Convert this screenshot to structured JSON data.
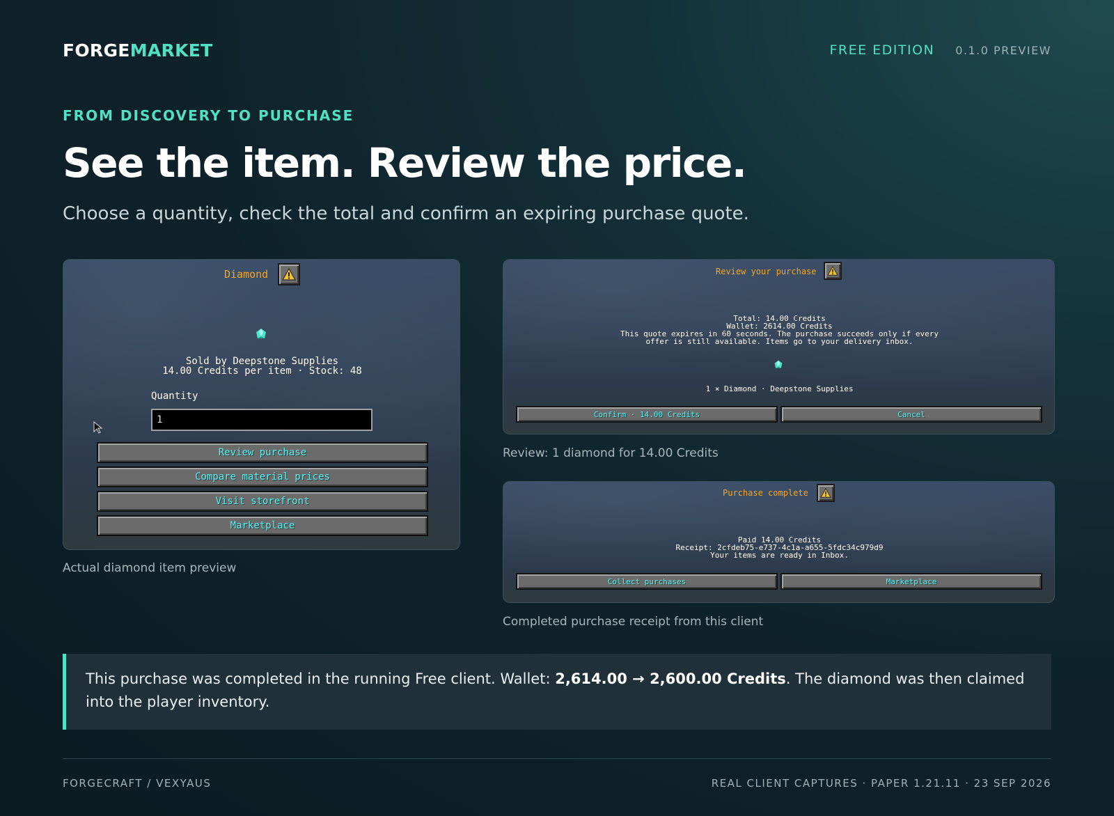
{
  "header": {
    "brand_part1": "FORGE",
    "brand_part2": "MARKET",
    "edition": "FREE EDITION",
    "version": "0.1.0 PREVIEW"
  },
  "hero": {
    "eyebrow": "FROM DISCOVERY TO PURCHASE",
    "headline": "See the item. Review the price.",
    "subhead": "Choose a quantity, check the total and confirm an expiring purchase quote."
  },
  "item_preview": {
    "title": "Diamond",
    "seller_line": "Sold by Deepstone Supplies",
    "price_line": "14.00 Credits per item · Stock: 48",
    "quantity_label": "Quantity",
    "quantity_value": "1",
    "buttons": [
      "Review purchase",
      "Compare material prices",
      "Visit storefront",
      "Marketplace"
    ],
    "caption": "Actual diamond item preview"
  },
  "review": {
    "title": "Review your purchase",
    "total": "Total: 14.00 Credits",
    "wallet": "Wallet: 2614.00 Credits",
    "notice_line1": "This quote expires in 60 seconds. The purchase succeeds only if every",
    "notice_line2": "offer is still available. Items go to your delivery inbox.",
    "summary": "1 × Diamond · Deepstone Supplies",
    "confirm_label": "Confirm · 14.00 Credits",
    "cancel_label": "Cancel",
    "caption": "Review: 1 diamond for 14.00 Credits"
  },
  "receipt": {
    "title": "Purchase complete",
    "paid": "Paid 14.00 Credits",
    "receipt_id": "Receipt: 2cfdeb75-e737-4c1a-a655-5fdc34c979d9",
    "inbox_note": "Your items are ready in Inbox.",
    "collect_label": "Collect purchases",
    "marketplace_label": "Marketplace",
    "caption": "Completed purchase receipt from this client"
  },
  "callout": {
    "text_before": "This purchase was completed in the running Free client. Wallet: ",
    "wallet_change": "2,614.00 → 2,600.00 Credits",
    "text_after": ". The diamond was then claimed into the player inventory."
  },
  "footer": {
    "left": "FORGECRAFT / VEXYAUS",
    "right": "REAL CLIENT CAPTURES · PAPER 1.21.11 · 23 SEP 2026"
  },
  "colors": {
    "accent": "#52e0c4",
    "mc_title": "#f5a623",
    "mc_button_text": "#5ff0f0",
    "warning": "#f2c230"
  },
  "icons": {
    "warning": "warning-triangle-icon",
    "gem": "diamond-icon",
    "cursor": "mouse-cursor-icon"
  }
}
